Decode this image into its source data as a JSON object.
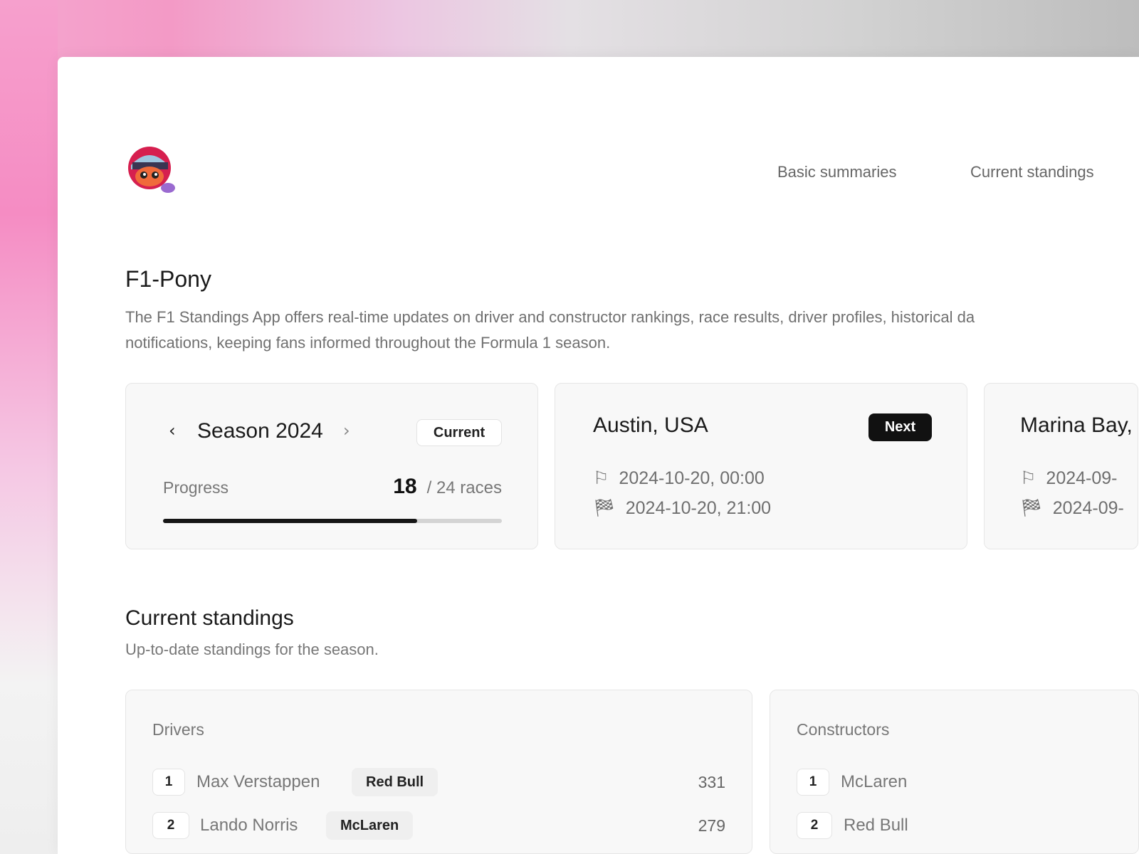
{
  "nav": {
    "items": [
      {
        "label": "Basic summaries"
      },
      {
        "label": "Current standings"
      }
    ]
  },
  "app": {
    "title": "F1-Pony",
    "description_line1": "The F1 Standings App offers real-time updates on driver and constructor rankings, race results, driver profiles, historical da",
    "description_line2": "notifications, keeping fans informed throughout the Formula 1 season.",
    "logo": "helmet-pony-mascot"
  },
  "season": {
    "label": "Season 2024",
    "badge": "Current",
    "progress_label": "Progress",
    "completed": "18",
    "total_label": "/ 24 races",
    "progress_fraction": 0.75
  },
  "races": [
    {
      "city": "Austin, USA",
      "badge": "Next",
      "start": "2024-10-20, 00:00",
      "finish": "2024-10-20, 21:00"
    },
    {
      "city": "Marina Bay,",
      "start": "2024-09-",
      "finish": "2024-09-"
    }
  ],
  "standings": {
    "title": "Current standings",
    "subtitle": "Up-to-date standings for the season.",
    "drivers": {
      "label": "Drivers",
      "rows": [
        {
          "rank": "1",
          "name": "Max Verstappen",
          "team": "Red Bull",
          "points": "331"
        },
        {
          "rank": "2",
          "name": "Lando Norris",
          "team": "McLaren",
          "points": "279"
        }
      ]
    },
    "constructors": {
      "label": "Constructors",
      "rows": [
        {
          "rank": "1",
          "name": "McLaren"
        },
        {
          "rank": "2",
          "name": "Red Bull"
        }
      ]
    }
  },
  "colors": {
    "accent": "#1a1a1a",
    "background_pink": "#f39ac6"
  }
}
